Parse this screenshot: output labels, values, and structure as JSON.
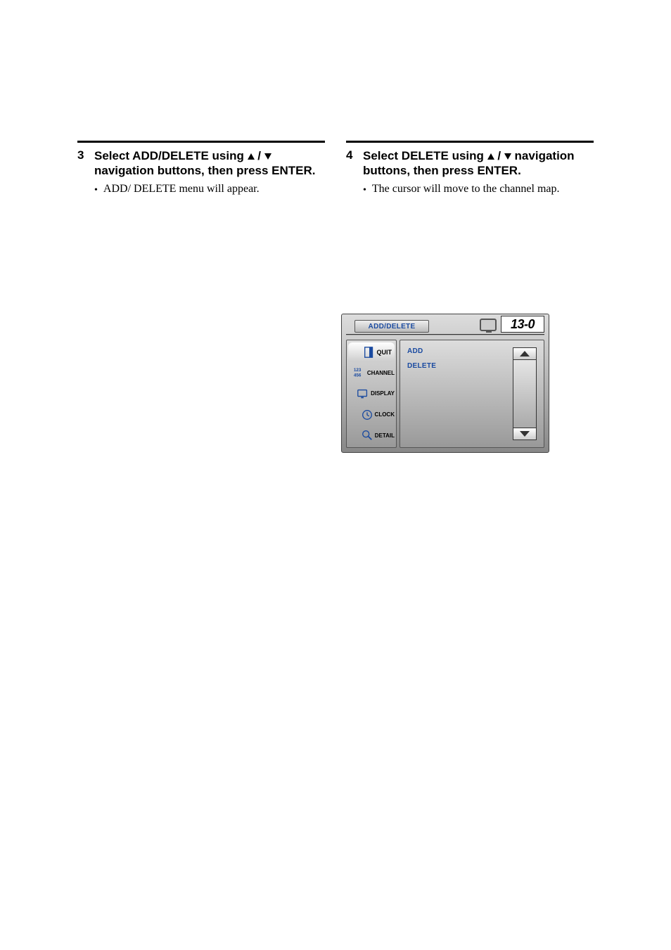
{
  "left": {
    "num": "3",
    "text_pre": "Select ADD/DELETE using ",
    "text_mid": " / ",
    "text_post": " navigation buttons, then press ENTER.",
    "note": "ADD/ DELETE menu will appear."
  },
  "right": {
    "num": "4",
    "text_pre": "Select DELETE using ",
    "text_mid": " / ",
    "text_post": " navigation buttons, then press ENTER.",
    "note": "The cursor will move to the channel map."
  },
  "osd": {
    "tab": "ADD/DELETE",
    "channel": "13-0",
    "sidebar": [
      "QUIT",
      "CHANNEL",
      "DISPLAY",
      "CLOCK",
      "DETAIL"
    ],
    "options": [
      "ADD",
      "DELETE"
    ]
  }
}
